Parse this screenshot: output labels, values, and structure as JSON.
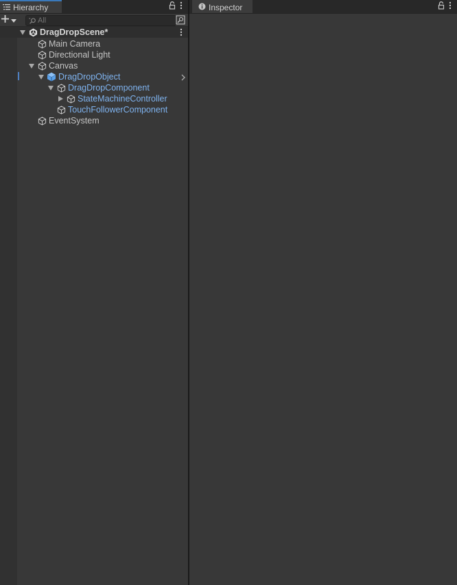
{
  "hierarchy": {
    "tab_label": "Hierarchy",
    "search_placeholder": "All",
    "scene": "DragDropScene*",
    "items": [
      {
        "label": "Main Camera"
      },
      {
        "label": "Directional Light"
      },
      {
        "label": "Canvas"
      },
      {
        "label": "DragDropObject"
      },
      {
        "label": "DragDropComponent"
      },
      {
        "label": "StateMachineController"
      },
      {
        "label": "TouchFollowerComponent"
      },
      {
        "label": "EventSystem"
      }
    ]
  },
  "inspector": {
    "tab_label": "Inspector"
  },
  "colors": {
    "accent": "#3a79bb",
    "prefab_text": "#7fb3ef",
    "background": "#383838"
  }
}
